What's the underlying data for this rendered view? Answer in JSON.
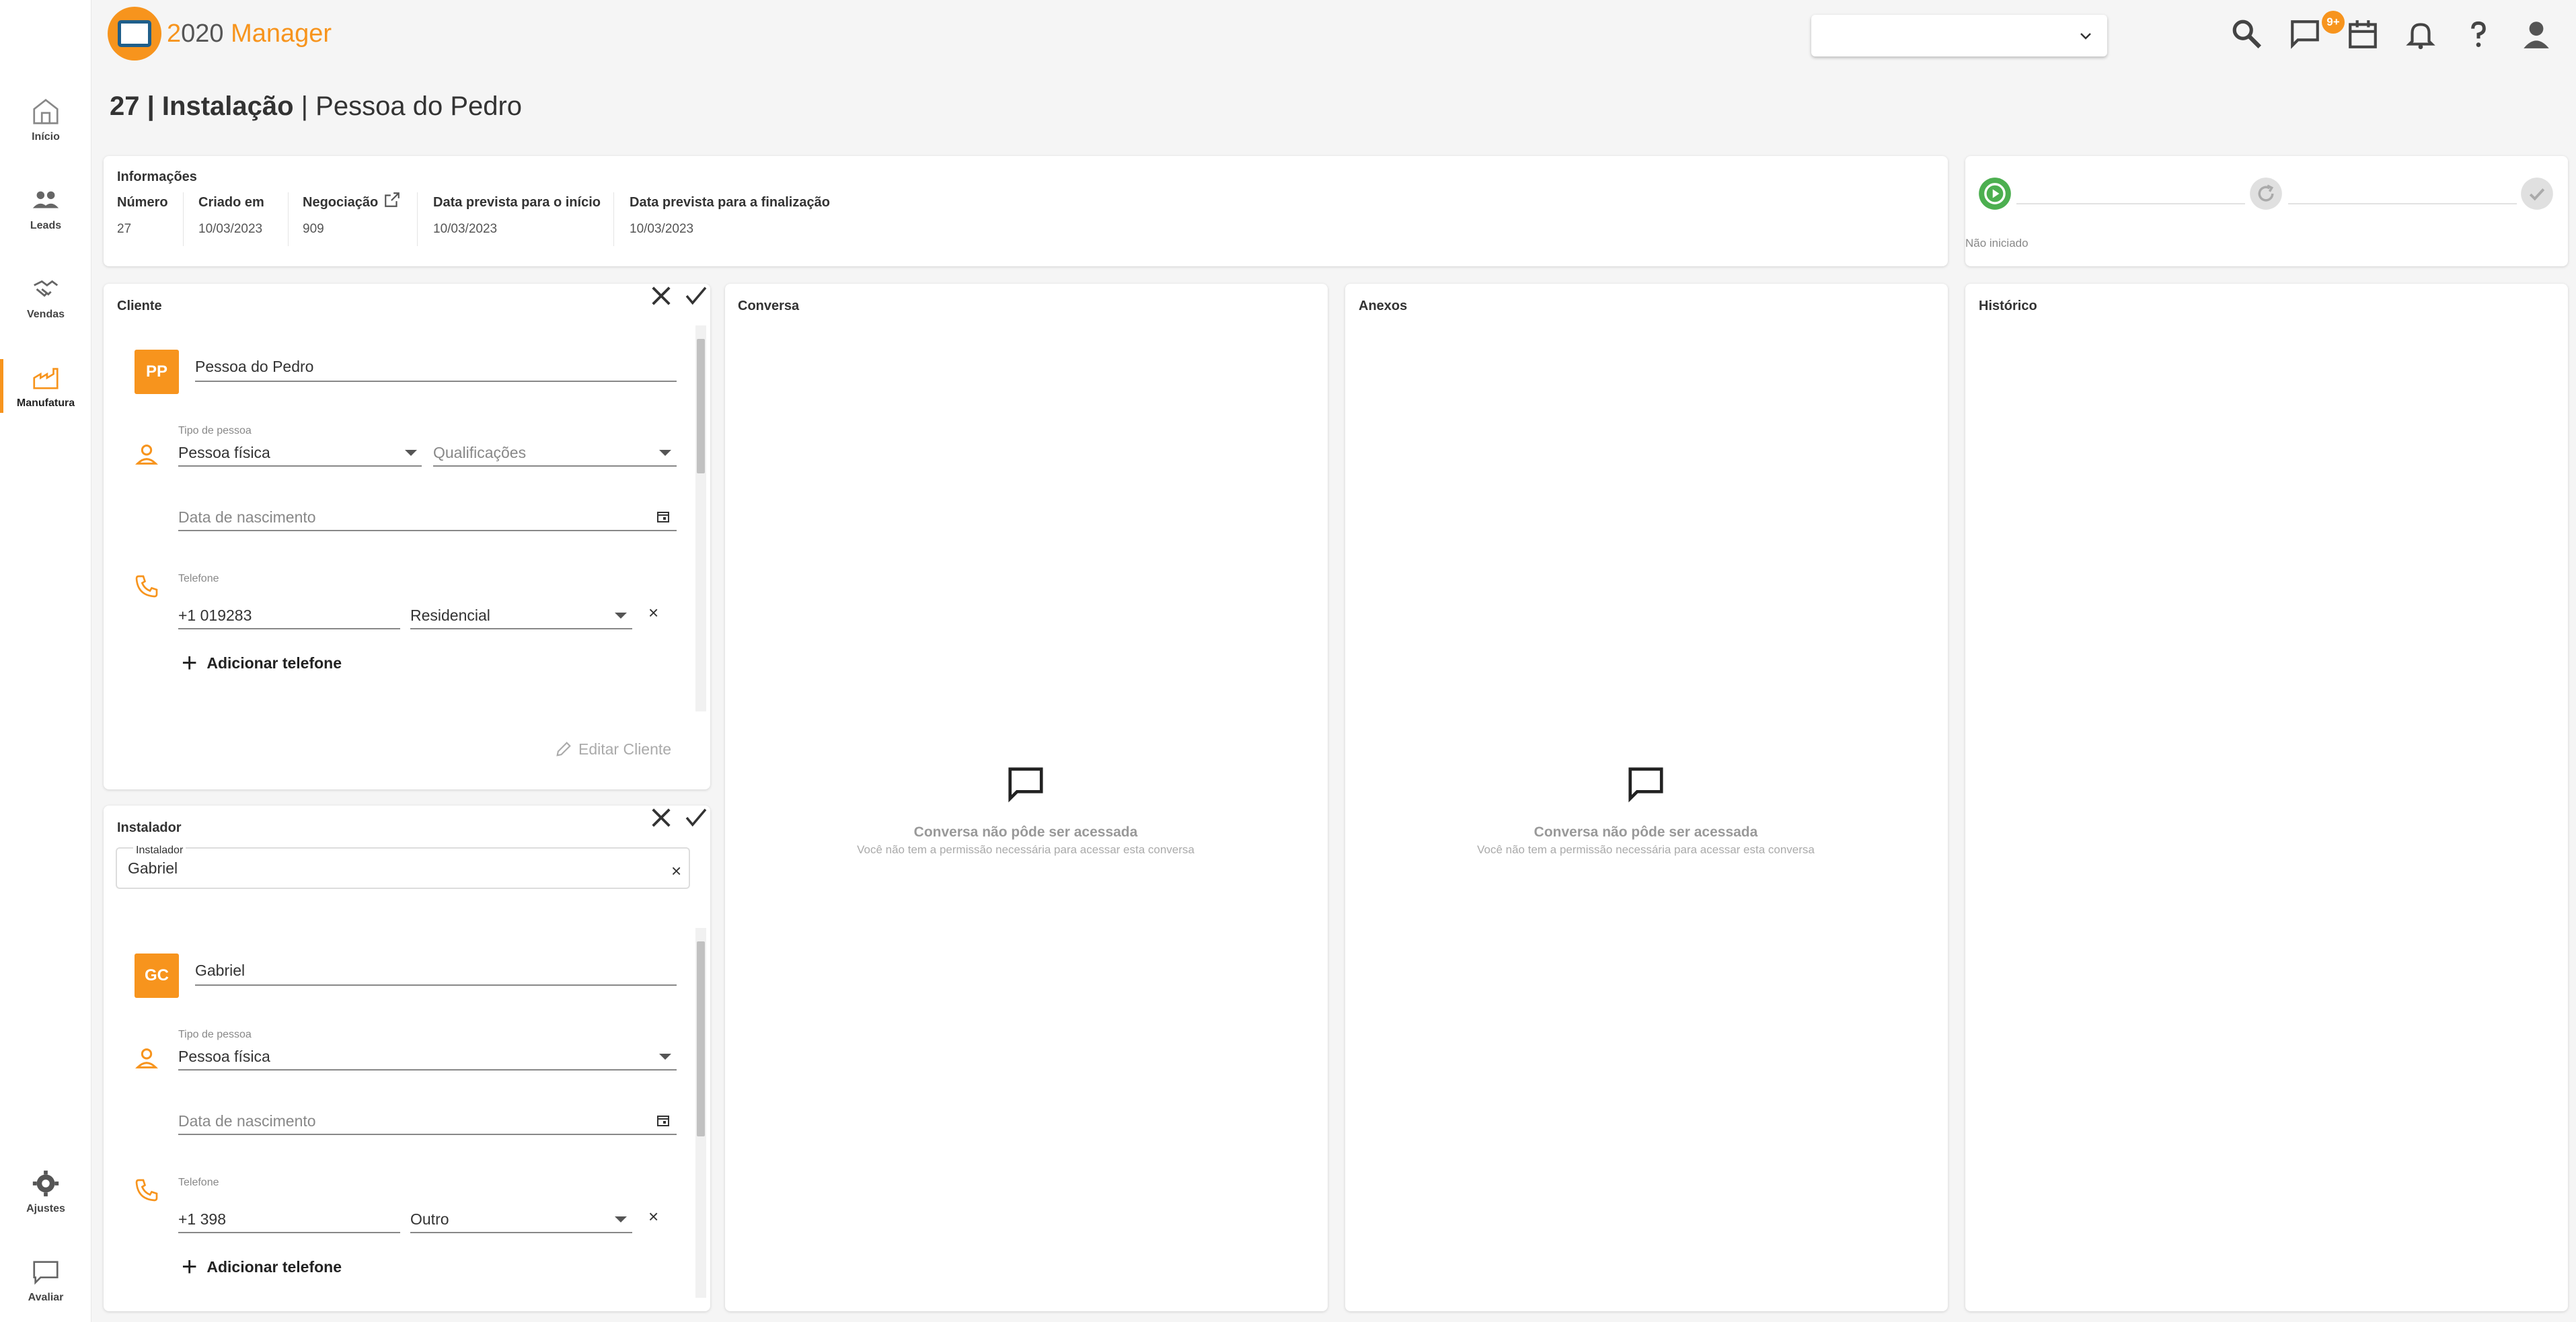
{
  "app": {
    "brand_prefix": "2",
    "brand_mid": "020 ",
    "brand_name": "Manager"
  },
  "sidebar": {
    "items": [
      {
        "label": "Início",
        "icon": "home-icon"
      },
      {
        "label": "Leads",
        "icon": "people-icon"
      },
      {
        "label": "Vendas",
        "icon": "handshake-icon"
      },
      {
        "label": "Manufatura",
        "icon": "factory-icon",
        "active": true
      }
    ],
    "bottom": [
      {
        "label": "Ajustes",
        "icon": "gear-icon"
      },
      {
        "label": "Avaliar",
        "icon": "feedback-icon"
      }
    ]
  },
  "topbar": {
    "notifications_badge": "9+",
    "select_value": ""
  },
  "page": {
    "title_bold": "27 | Instalação",
    "title_rest": " | Pessoa do Pedro"
  },
  "info": {
    "title": "Informações",
    "columns": [
      {
        "label": "Número",
        "value": "27"
      },
      {
        "label": "Criado em",
        "value": "10/03/2023"
      },
      {
        "label": "Negociação",
        "value": "909"
      },
      {
        "label": "Data prevista para o início",
        "value": "10/03/2023"
      },
      {
        "label": "Data prevista para a finalização",
        "value": "10/03/2023"
      }
    ]
  },
  "progress": {
    "status": "Não iniciado"
  },
  "cliente": {
    "title": "Cliente",
    "avatar": "PP",
    "name": "Pessoa do Pedro",
    "tipo_label": "Tipo de pessoa",
    "tipo_value": "Pessoa física",
    "qualificacoes_placeholder": "Qualificações",
    "nascimento_placeholder": "Data de nascimento",
    "telefone_label": "Telefone",
    "telefone_value": "+1 019283",
    "telefone_tipo": "Residencial",
    "add_phone": "Adicionar telefone",
    "edit": "Editar Cliente"
  },
  "instalador": {
    "title": "Instalador",
    "select_label": "Instalador",
    "select_value": "Gabriel",
    "avatar": "GC",
    "name": "Gabriel",
    "tipo_label": "Tipo de pessoa",
    "tipo_value": "Pessoa física",
    "nascimento_placeholder": "Data de nascimento",
    "telefone_label": "Telefone",
    "telefone_value": "+1 398",
    "telefone_tipo": "Outro",
    "add_phone": "Adicionar telefone"
  },
  "conversa": {
    "title": "Conversa",
    "empty_title": "Conversa não pôde ser acessada",
    "empty_sub": "Você não tem a permissão necessária para acessar esta conversa"
  },
  "anexos": {
    "title": "Anexos",
    "empty_title": "Conversa não pôde ser acessada",
    "empty_sub": "Você não tem a permissão necessária para acessar esta conversa"
  },
  "historico": {
    "title": "Histórico"
  },
  "colors": {
    "accent": "#f7941d",
    "success": "#4caf50"
  }
}
